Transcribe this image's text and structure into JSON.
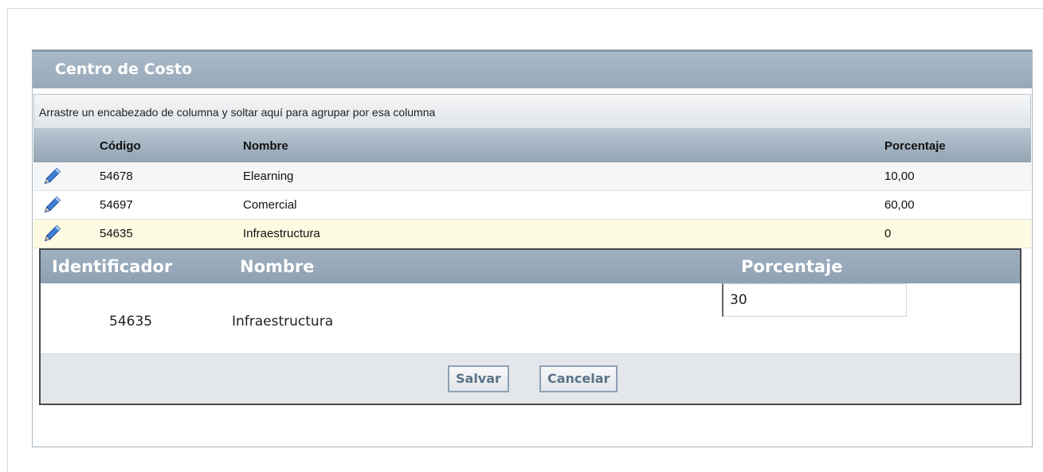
{
  "panel": {
    "title": "Centro de Costo",
    "group_hint": "Arrastre un encabezado de columna y soltar aquí para agrupar por esa columna"
  },
  "grid": {
    "columns": [
      "Código",
      "Nombre",
      "Porcentaje"
    ],
    "rows": [
      {
        "codigo": "54678",
        "nombre": "Elearning",
        "porcentaje": "10,00",
        "icon": "pencil-icon"
      },
      {
        "codigo": "54697",
        "nombre": "Comercial",
        "porcentaje": "60,00",
        "icon": "pencil-icon"
      },
      {
        "codigo": "54635",
        "nombre": "Infraestructura",
        "porcentaje": "0",
        "icon": "pencil-icon"
      }
    ]
  },
  "edit_form": {
    "headers": [
      "Identificador",
      "Nombre",
      "Porcentaje"
    ],
    "identificador": "54635",
    "nombre": "Infraestructura",
    "porcentaje_value": "30",
    "save_label": "Salvar",
    "cancel_label": "Cancelar"
  },
  "colors": {
    "header_blue": "#97aab9",
    "selected_row": "#fdfbe1",
    "button_text": "#5a7389"
  }
}
